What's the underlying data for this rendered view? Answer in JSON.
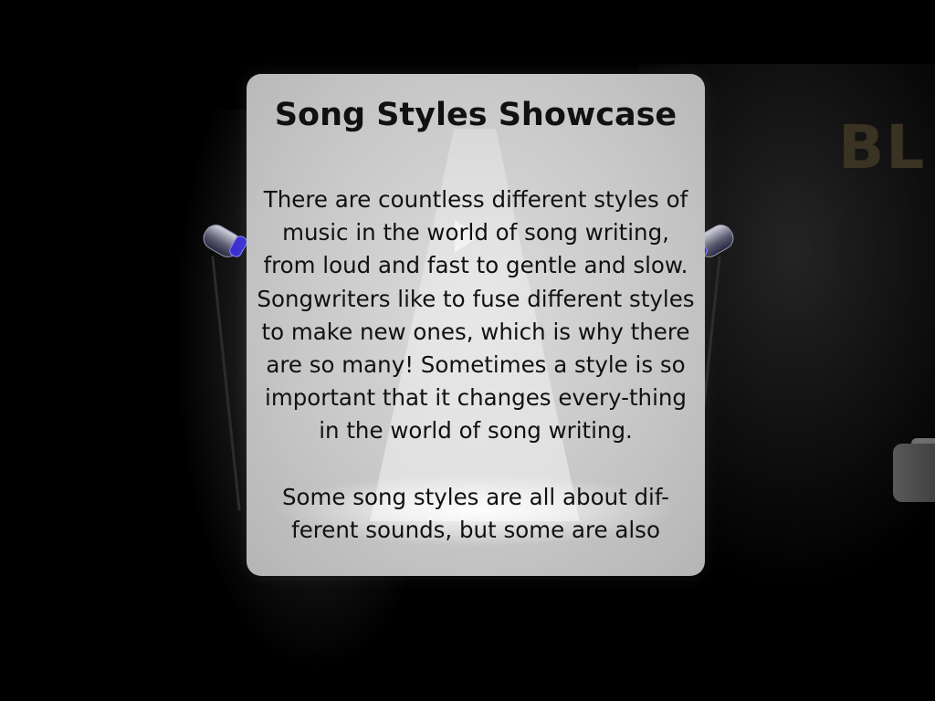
{
  "sign": {
    "text": "BL"
  },
  "showcase": {
    "title": "Song Styles Showcase",
    "paragraphs": [
      "There are countless different styles of music in the world of song writing, from loud and fast to gentle and slow.  Songwriters like to fuse different styles to make new ones, which is why there are so many!  Sometimes a style is so important that it changes every-thing in the world of song writing.",
      "Some song styles are all about dif-ferent sounds, but some are also"
    ]
  },
  "colors": {
    "background": "#000000",
    "panel": "#c8c8c8",
    "text": "#111111",
    "lamp_accent": "#3b2fd0"
  }
}
